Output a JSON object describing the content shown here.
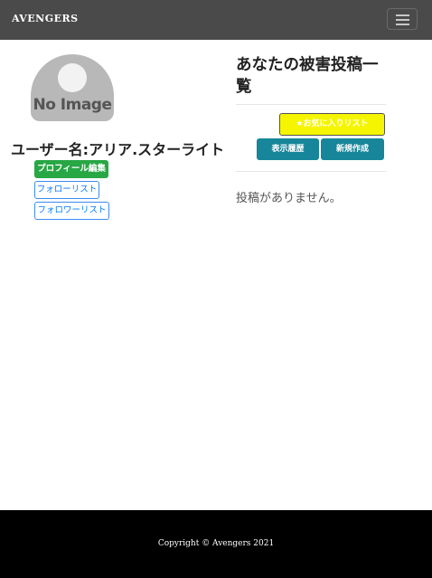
{
  "navbar": {
    "brand": "AVENGERS",
    "toggle_icon": "hamburger-icon"
  },
  "profile": {
    "avatar_text": "No Image",
    "username": "ユーザー名:アリア.スターライト",
    "edit_label": "プロフィール編集",
    "follow_list_label": "フォローリスト",
    "follower_list_label": "フォロワーリスト"
  },
  "posts": {
    "title": "あなたの被害投稿一覧",
    "favorites_label": "★お気に入りリスト",
    "history_label": "表示履歴",
    "new_label": "新規作成",
    "empty_message": "投稿がありません。"
  },
  "footer": {
    "copyright": "Copyright © Avengers 2021"
  },
  "colors": {
    "navbar": "#4a4a4a",
    "green": "#28a745",
    "outline_blue": "#007bff",
    "yellow": "#f5f500",
    "teal": "#17869a",
    "footer": "#000000"
  }
}
